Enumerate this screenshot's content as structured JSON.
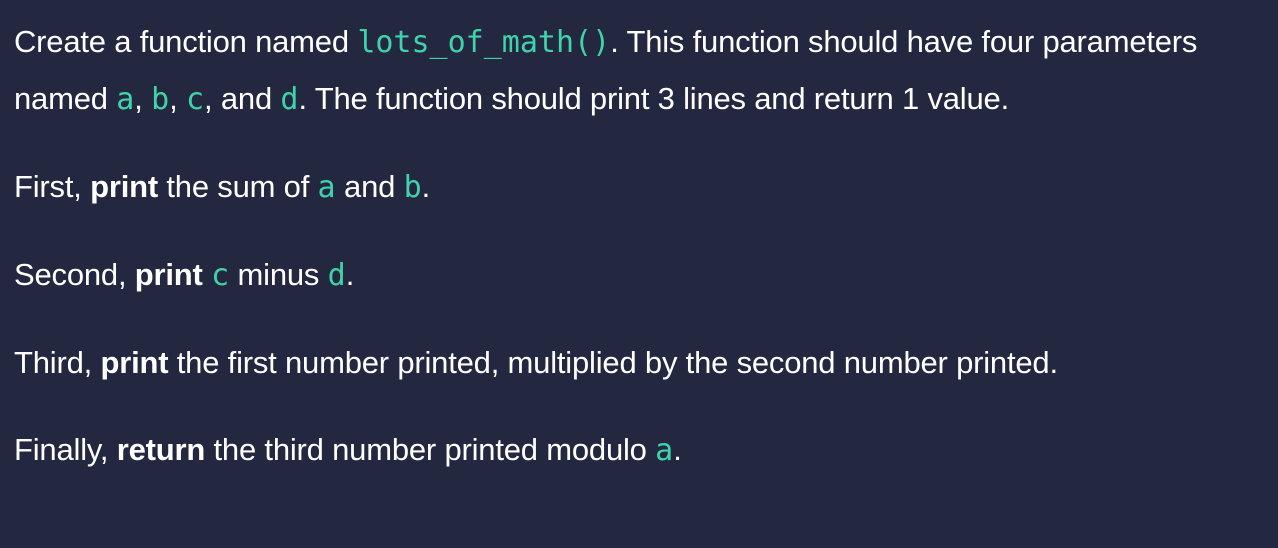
{
  "paragraphs": {
    "p1": {
      "t1": "Create a function named ",
      "c_func": "lots_of_math()",
      "t2": ". This function should have four parameters named ",
      "c_a": "a",
      "t3": ", ",
      "c_b": "b",
      "t4": ", ",
      "c_c": "c",
      "t5": ", and ",
      "c_d": "d",
      "t6": ". The function should print 3 lines and return 1 value."
    },
    "p2": {
      "t1": "First, ",
      "bold": "print",
      "t2": " the sum of ",
      "c_a": "a",
      "t3": " and ",
      "c_b": "b",
      "t4": "."
    },
    "p3": {
      "t1": "Second, ",
      "bold": "print",
      "t2": " ",
      "c_c": "c",
      "t3": " minus ",
      "c_d": "d",
      "t4": "."
    },
    "p4": {
      "t1": "Third, ",
      "bold": "print",
      "t2": " the first number printed, multiplied by the second number printed."
    },
    "p5": {
      "t1": "Finally, ",
      "bold": "return",
      "t2": " the third number printed modulo ",
      "c_a": "a",
      "t3": "."
    }
  },
  "colors": {
    "background": "#232840",
    "text": "#ffffff",
    "code_accent": "#3fd3a9"
  }
}
